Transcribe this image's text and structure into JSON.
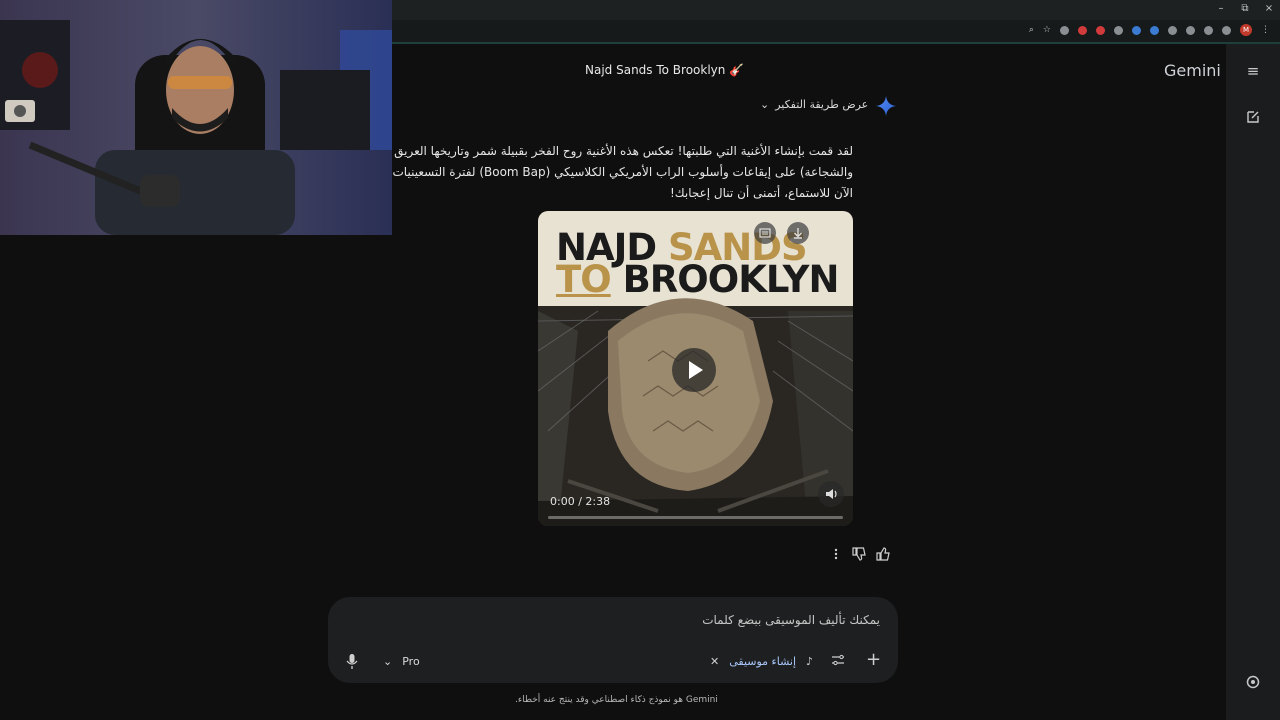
{
  "browser": {
    "window_controls": [
      "–",
      "⧉",
      "×"
    ],
    "profile_initial": "M"
  },
  "app": {
    "brand": "Gemini",
    "conversation_title": "Najd Sands To Brooklyn 🎸"
  },
  "thinking": {
    "label": "عرض طريقة التفكير"
  },
  "response": {
    "lines": [
      "لقد قمت بإنشاء الأغنية التي طلبتها! تعكس هذه الأغنية روح الفخر بقبيلة شمر وتاريخها العريق (مثل الكرم",
      "والشجاعة) على إيقاعات وأسلوب الراب الأمريكي الكلاسيكي (Boom Bap) لفترة التسعينيات. الأغنية جاهزة",
      "الآن للاستماع، أتمنى أن تنال إعجابك!"
    ]
  },
  "player": {
    "poster_line1_a": "NAJD",
    "poster_line1_b": "SANDS",
    "poster_line2_a": "TO",
    "poster_line2_b": "BROOKLYN",
    "timecode": "0:00 / 2:38",
    "progress": 0
  },
  "composer": {
    "placeholder": "يمكنك تأليف الموسيقى ببضع كلمات",
    "tool_chip": "إنشاء موسيقى",
    "model": "Pro"
  },
  "footer": {
    "disclaimer": "Gemini هو نموذج ذكاء اصطناعي وقد ينتج عنه أخطاء."
  },
  "colors": {
    "accent_gold": "#b9934a",
    "poster_bg": "#e8e2d3",
    "poster_text": "#1b1b1b",
    "chip_text": "#a8c7fa"
  }
}
